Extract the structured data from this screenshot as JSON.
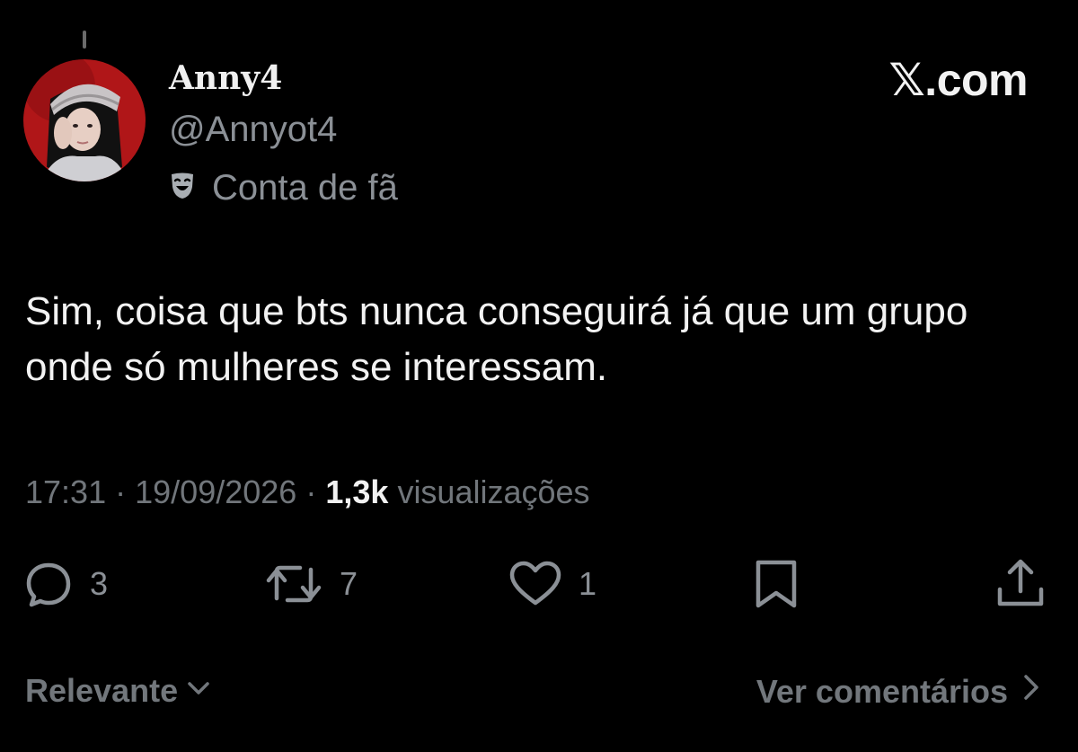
{
  "author": {
    "display_name": "Anny4",
    "handle": "@Annyot4",
    "label_icon": "theater-mask-icon",
    "label": "Conta de fã",
    "avatar_icon": "profile-photo"
  },
  "brand": "𝕏.com",
  "tweet": {
    "text": "Sim, coisa que bts nunca conseguirá já que um grupo onde só mulheres se interessam."
  },
  "meta": {
    "time": "17:31",
    "separator": "·",
    "date": "19/09/2026",
    "views_count": "1,3k",
    "views_label": "visualizações"
  },
  "actions": {
    "reply_icon": "reply-bubble-icon",
    "reply_count": "3",
    "repost_icon": "repost-arrows-icon",
    "repost_count": "7",
    "like_icon": "heart-icon",
    "like_count": "1",
    "bookmark_icon": "bookmark-icon",
    "share_icon": "share-upload-icon"
  },
  "footer": {
    "sort_label": "Relevante",
    "comments_label": "Ver comentários"
  },
  "colors": {
    "background": "#000000",
    "primary_text": "#f2f2f2",
    "secondary_text": "#8b9096",
    "avatar_bg": "#b01618"
  }
}
